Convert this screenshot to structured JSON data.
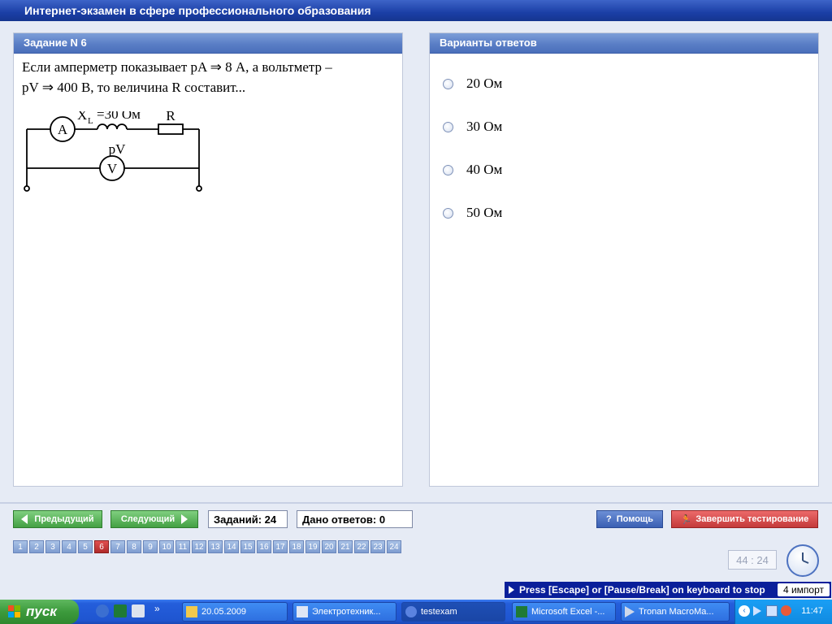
{
  "app": {
    "title": "Интернет-экзамен в сфере профессионального образования"
  },
  "question": {
    "header": "Задание N 6",
    "line1": "Если амперметр показывает pA ⇒ 8  А, а вольтметр –",
    "line2": "pV ⇒ 400  В, то величина  R  составит...",
    "circuit": {
      "ammeter": "A",
      "voltmeter": "V",
      "xl_symbol": "X",
      "xl_sub": "L",
      "xl_value": "=30 Ом",
      "resistor": "R",
      "pv": "pV"
    }
  },
  "answers": {
    "header": "Варианты ответов",
    "options": [
      "20 Ом",
      "30 Ом",
      "40 Ом",
      "50 Ом"
    ]
  },
  "nav": {
    "prev": "Предыдущий",
    "next": "Следующий",
    "tasks_count": "Заданий: 24",
    "answered": "Дано ответов: 0",
    "help": "Помощь",
    "finish": "Завершить тестирование",
    "pages": [
      "1",
      "2",
      "3",
      "4",
      "5",
      "6",
      "7",
      "8",
      "9",
      "10",
      "11",
      "12",
      "13",
      "14",
      "15",
      "16",
      "17",
      "18",
      "19",
      "20",
      "21",
      "22",
      "23",
      "24"
    ],
    "active_page": "6",
    "timer": "44 : 24"
  },
  "escape_bar": {
    "text": "Press [Escape] or [Pause/Break] on keyboard to stop",
    "import": "4 импорт"
  },
  "taskbar": {
    "start": "пуск",
    "tasks": [
      "20.05.2009",
      "Электротехник...",
      "testexam",
      "Microsoft Excel -...",
      "Tronan MacroMa..."
    ],
    "time": "11:47",
    "quicklaunch_overflow": "»"
  },
  "colors": {
    "title_bg": "#1b3fa6",
    "panel_head": "#5a7ec6",
    "green": "#43a043",
    "red": "#c43a3a",
    "page_active": "#b02a2a"
  }
}
